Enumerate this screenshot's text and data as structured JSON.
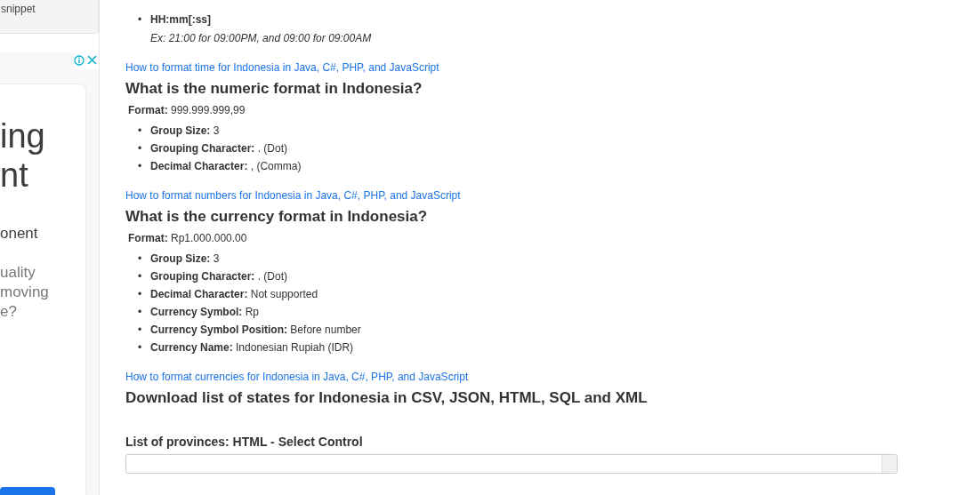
{
  "sidebar": {
    "snippet_card": {
      "text": "snippet"
    },
    "ad": {
      "lines": [
        {
          "text": "ing",
          "kind": "big"
        },
        {
          "text": "nt",
          "kind": "big"
        },
        {
          "text": "onent",
          "kind": "mid"
        },
        {
          "text": "uality",
          "kind": "small"
        },
        {
          "text": "moving",
          "kind": "small"
        },
        {
          "text": "e?",
          "kind": "small"
        }
      ]
    }
  },
  "time_formats": [
    {
      "marker": "•",
      "pattern": "HH:mm[:ss]",
      "example": "Ex: 21:00 for 09:00PM, and 09:00 for 09:00AM"
    }
  ],
  "sections": [
    {
      "link": "How to format time for Indonesia in Java, C#, PHP, and JavaScript",
      "heading": "What is the numeric format in Indonesia?",
      "format": {
        "label": "Format:",
        "value": "999.999.999,99"
      },
      "items": [
        {
          "marker": "•",
          "label": "Group Size:",
          "value": "3"
        },
        {
          "marker": "•",
          "label": "Grouping Character:",
          "value": ". (Dot)"
        },
        {
          "marker": "•",
          "label": "Decimal Character:",
          "value": ", (Comma)"
        }
      ]
    },
    {
      "link": "How to format numbers for Indonesia in Java, C#, PHP, and JavaScript",
      "heading": "What is the currency format in Indonesia?",
      "format": {
        "label": "Format:",
        "value": "Rp1.000.000.00"
      },
      "items": [
        {
          "marker": "•",
          "label": "Group Size:",
          "value": "3"
        },
        {
          "marker": "•",
          "label": "Grouping Character:",
          "value": ". (Dot)"
        },
        {
          "marker": "•",
          "label": "Decimal Character:",
          "value": "Not supported"
        },
        {
          "marker": "•",
          "label": "Currency Symbol:",
          "value": "Rp"
        },
        {
          "marker": "•",
          "label": "Currency Symbol Position:",
          "value": "Before number"
        },
        {
          "marker": "•",
          "label": "Currency Name:",
          "value": "Indonesian Rupiah (IDR)"
        }
      ]
    },
    {
      "link": "How to format currencies for Indonesia in Java, C#, PHP, and JavaScript",
      "heading": "Download list of states for Indonesia in CSV, JSON, HTML, SQL and XML"
    }
  ],
  "select_section": {
    "label": "List of provinces: HTML - Select Control"
  }
}
